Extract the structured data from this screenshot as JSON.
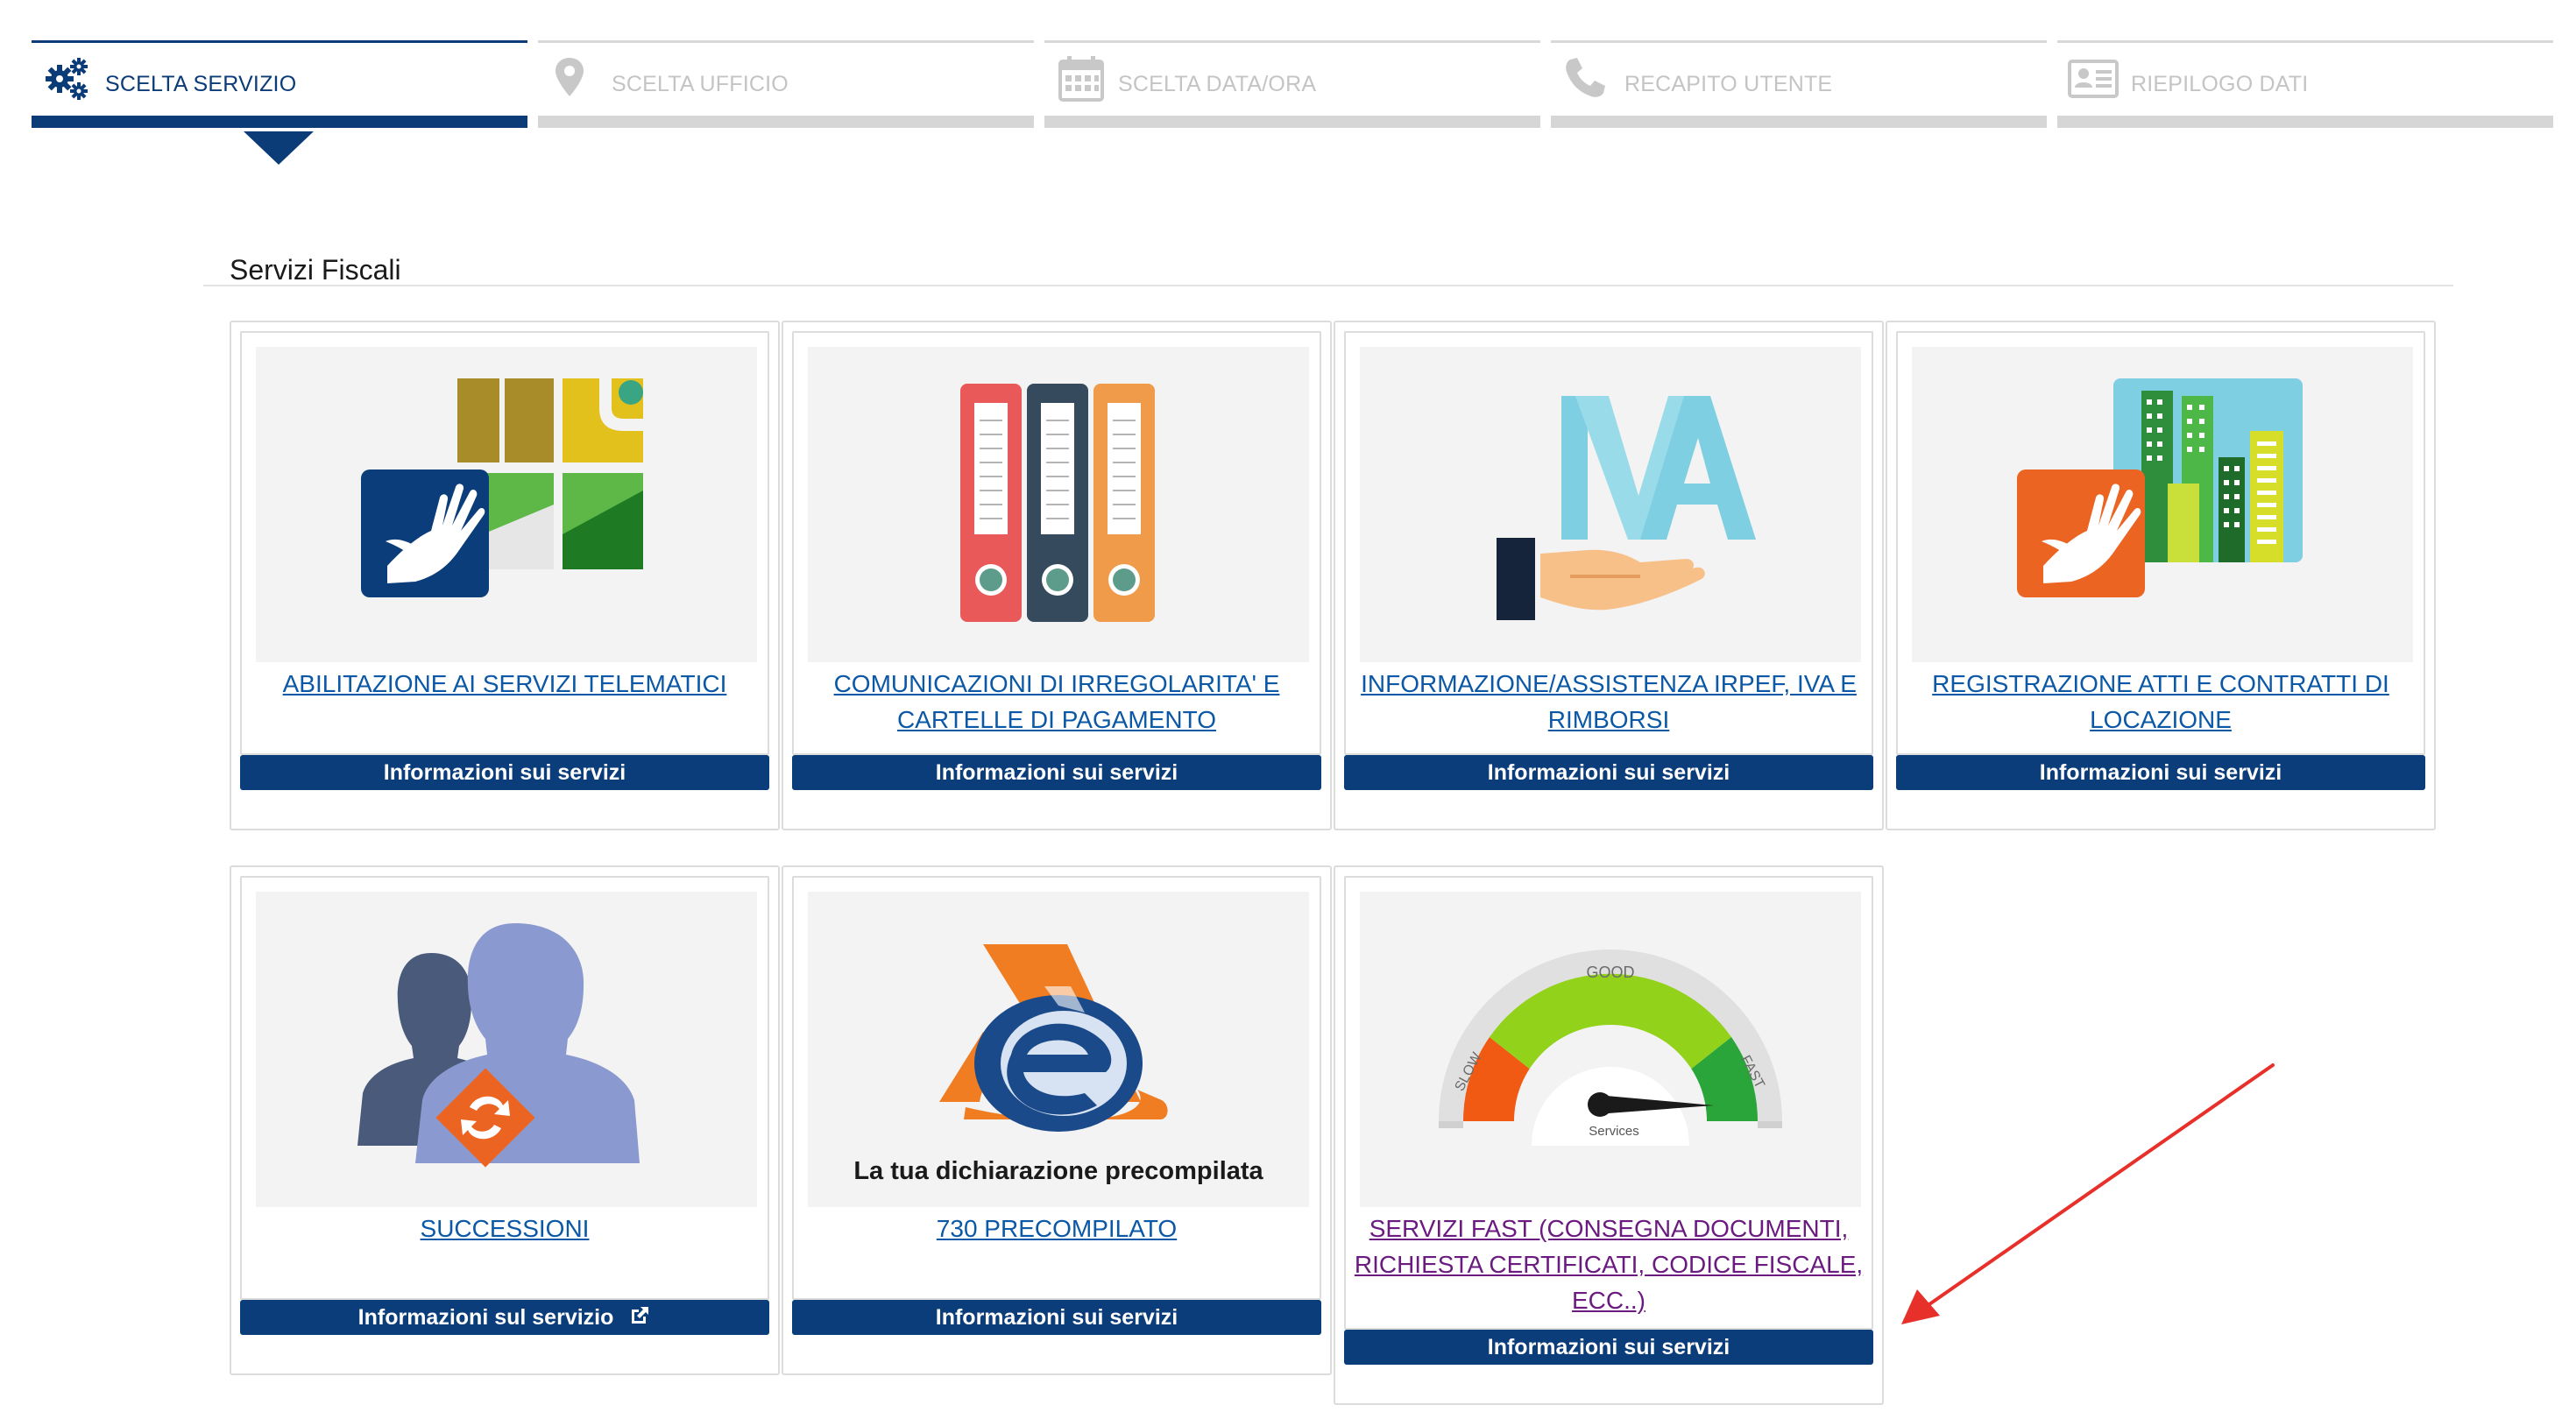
{
  "stepper": {
    "steps": [
      {
        "label": "SCELTA SERVIZIO",
        "icon": "gears-icon",
        "state": "active"
      },
      {
        "label": "SCELTA UFFICIO",
        "icon": "map-marker-icon",
        "state": "inactive"
      },
      {
        "label": "SCELTA DATA/ORA",
        "icon": "calendar-icon",
        "state": "inactive"
      },
      {
        "label": "RECAPITO UTENTE",
        "icon": "phone-icon",
        "state": "inactive"
      },
      {
        "label": "RIEPILOGO DATI",
        "icon": "id-card-icon",
        "state": "inactive"
      }
    ]
  },
  "section": {
    "title": "Servizi Fiscali"
  },
  "cards": [
    {
      "title": "ABILITAZIONE AI SERVIZI TELEMATICI",
      "button": "Informazioni sui servizi",
      "image": "hand-map-illustration"
    },
    {
      "title": "COMUNICAZIONI DI IRREGOLARITA' E CARTELLE DI PAGAMENTO",
      "button": "Informazioni sui servizi",
      "image": "binders-illustration"
    },
    {
      "title": "INFORMAZIONE/ASSISTENZA IRPEF, IVA E RIMBORSI",
      "button": "Informazioni sui servizi",
      "image": "hand-letters-illustration"
    },
    {
      "title": "REGISTRAZIONE ATTI E CONTRATTI DI LOCAZIONE",
      "button": "Informazioni sui servizi",
      "image": "hand-buildings-illustration"
    },
    {
      "title": "SUCCESSIONI",
      "button": "Informazioni sul servizio",
      "button_icon": "external-link-icon",
      "image": "people-swap-illustration"
    },
    {
      "title": "730 PRECOMPILATO",
      "button": "Informazioni sui servizi",
      "image": "precompilata-logo",
      "image_caption": "La tua  dichiarazione precompilata"
    },
    {
      "title": "SERVIZI FAST (CONSEGNA DOCUMENTI, RICHIESTA CERTIFICATI, CODICE FISCALE, ECC..)",
      "button": "Informazioni sui servizi",
      "image": "speedometer-illustration",
      "visited": true,
      "gauge": {
        "good": "GOOD",
        "slow": "SLOW",
        "fast": "FAST",
        "center": "Services"
      }
    }
  ],
  "annotation": {
    "type": "arrow",
    "color": "#e8302a"
  },
  "colors": {
    "brand": "#0b3d7a",
    "link": "#0b58a6",
    "visited": "#6b1a7f",
    "inactive": "#c4c4c4"
  }
}
